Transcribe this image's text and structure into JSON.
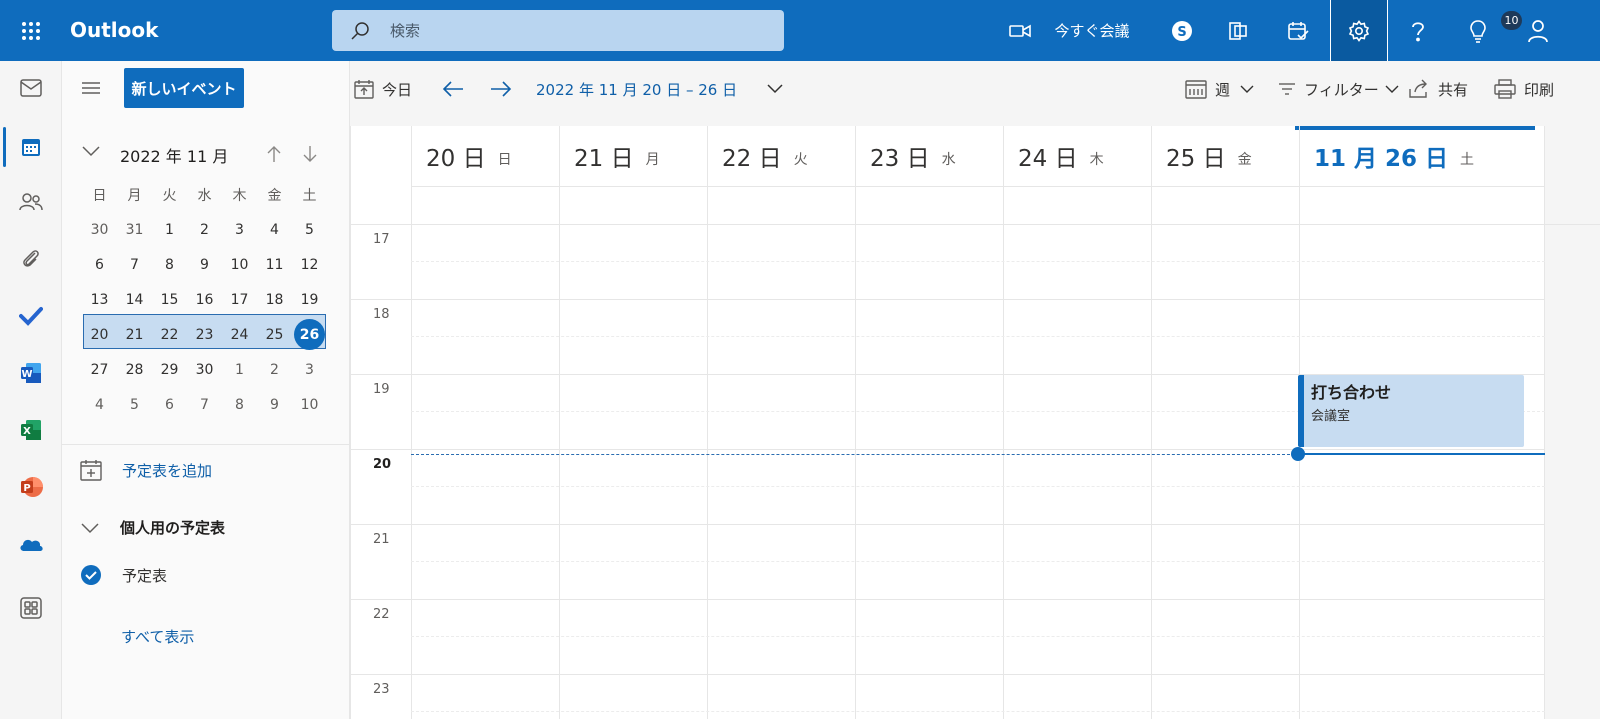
{
  "app": {
    "brand": "Outlook"
  },
  "colors": {
    "brand_blue": "#0f6cbd",
    "selection": "#c7dcf1"
  },
  "search": {
    "placeholder": "検索"
  },
  "topbar": {
    "meet_now": "今すぐ会議",
    "notification_count": "10",
    "icons": [
      "app-launcher-icon",
      "video-icon",
      "skype-icon",
      "office-icon",
      "calendar-check-icon",
      "gear-icon",
      "help-icon",
      "lightbulb-icon",
      "person-icon"
    ]
  },
  "rail": {
    "icons": [
      "mail-icon",
      "calendar-icon",
      "people-icon",
      "attachment-icon",
      "todo-icon",
      "word-icon",
      "excel-icon",
      "powerpoint-icon",
      "onedrive-icon",
      "more-apps-icon"
    ]
  },
  "nav": {
    "new_event": "新しいイベント",
    "mini_calendar": {
      "title": "2022 年 11 月",
      "weekdays": [
        "日",
        "月",
        "火",
        "水",
        "木",
        "金",
        "土"
      ],
      "weeks": [
        [
          "30",
          "31",
          "1",
          "2",
          "3",
          "4",
          "5"
        ],
        [
          "6",
          "7",
          "8",
          "9",
          "10",
          "11",
          "12"
        ],
        [
          "13",
          "14",
          "15",
          "16",
          "17",
          "18",
          "19"
        ],
        [
          "20",
          "21",
          "22",
          "23",
          "24",
          "25",
          "26"
        ],
        [
          "27",
          "28",
          "29",
          "30",
          "1",
          "2",
          "3"
        ],
        [
          "4",
          "5",
          "6",
          "7",
          "8",
          "9",
          "10"
        ]
      ],
      "selected_week": 3,
      "today": "26"
    },
    "add_calendar": "予定表を追加",
    "group_label": "個人用の予定表",
    "calendar_item": "予定表",
    "show_all": "すべて表示"
  },
  "toolbar": {
    "today": "今日",
    "range": "2022 年 11 月 20 日 – 26 日",
    "view": "週",
    "filter": "フィルター",
    "share": "共有",
    "print": "印刷"
  },
  "week": {
    "days": [
      {
        "num": "20 日",
        "dow": "日"
      },
      {
        "num": "21 日",
        "dow": "月"
      },
      {
        "num": "22 日",
        "dow": "火"
      },
      {
        "num": "23 日",
        "dow": "水"
      },
      {
        "num": "24 日",
        "dow": "木"
      },
      {
        "num": "25 日",
        "dow": "金"
      },
      {
        "num": "11 月 26 日",
        "dow": "土"
      }
    ],
    "today_index": 6,
    "hours": [
      "17",
      "18",
      "19",
      "20",
      "21",
      "22",
      "23"
    ],
    "current_hour": "20"
  },
  "event": {
    "title": "打ち合わせ",
    "location": "会議室",
    "day_index": 6,
    "start": "19:00",
    "end": "20:00"
  }
}
